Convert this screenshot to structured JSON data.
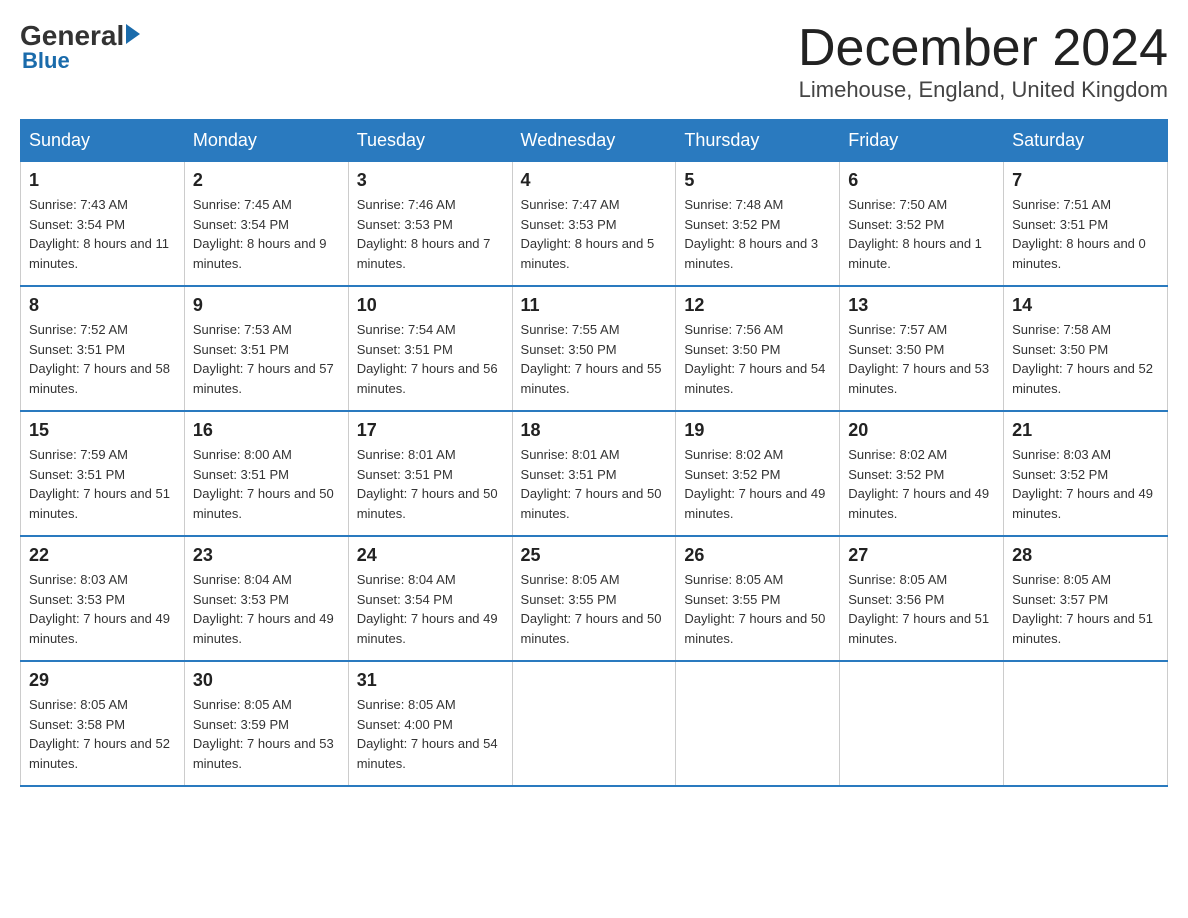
{
  "header": {
    "logo": {
      "general": "General",
      "blue": "Blue"
    },
    "title": "December 2024",
    "location": "Limehouse, England, United Kingdom"
  },
  "days_of_week": [
    "Sunday",
    "Monday",
    "Tuesday",
    "Wednesday",
    "Thursday",
    "Friday",
    "Saturday"
  ],
  "weeks": [
    [
      {
        "day": "1",
        "sunrise": "7:43 AM",
        "sunset": "3:54 PM",
        "daylight": "8 hours and 11 minutes."
      },
      {
        "day": "2",
        "sunrise": "7:45 AM",
        "sunset": "3:54 PM",
        "daylight": "8 hours and 9 minutes."
      },
      {
        "day": "3",
        "sunrise": "7:46 AM",
        "sunset": "3:53 PM",
        "daylight": "8 hours and 7 minutes."
      },
      {
        "day": "4",
        "sunrise": "7:47 AM",
        "sunset": "3:53 PM",
        "daylight": "8 hours and 5 minutes."
      },
      {
        "day": "5",
        "sunrise": "7:48 AM",
        "sunset": "3:52 PM",
        "daylight": "8 hours and 3 minutes."
      },
      {
        "day": "6",
        "sunrise": "7:50 AM",
        "sunset": "3:52 PM",
        "daylight": "8 hours and 1 minute."
      },
      {
        "day": "7",
        "sunrise": "7:51 AM",
        "sunset": "3:51 PM",
        "daylight": "8 hours and 0 minutes."
      }
    ],
    [
      {
        "day": "8",
        "sunrise": "7:52 AM",
        "sunset": "3:51 PM",
        "daylight": "7 hours and 58 minutes."
      },
      {
        "day": "9",
        "sunrise": "7:53 AM",
        "sunset": "3:51 PM",
        "daylight": "7 hours and 57 minutes."
      },
      {
        "day": "10",
        "sunrise": "7:54 AM",
        "sunset": "3:51 PM",
        "daylight": "7 hours and 56 minutes."
      },
      {
        "day": "11",
        "sunrise": "7:55 AM",
        "sunset": "3:50 PM",
        "daylight": "7 hours and 55 minutes."
      },
      {
        "day": "12",
        "sunrise": "7:56 AM",
        "sunset": "3:50 PM",
        "daylight": "7 hours and 54 minutes."
      },
      {
        "day": "13",
        "sunrise": "7:57 AM",
        "sunset": "3:50 PM",
        "daylight": "7 hours and 53 minutes."
      },
      {
        "day": "14",
        "sunrise": "7:58 AM",
        "sunset": "3:50 PM",
        "daylight": "7 hours and 52 minutes."
      }
    ],
    [
      {
        "day": "15",
        "sunrise": "7:59 AM",
        "sunset": "3:51 PM",
        "daylight": "7 hours and 51 minutes."
      },
      {
        "day": "16",
        "sunrise": "8:00 AM",
        "sunset": "3:51 PM",
        "daylight": "7 hours and 50 minutes."
      },
      {
        "day": "17",
        "sunrise": "8:01 AM",
        "sunset": "3:51 PM",
        "daylight": "7 hours and 50 minutes."
      },
      {
        "day": "18",
        "sunrise": "8:01 AM",
        "sunset": "3:51 PM",
        "daylight": "7 hours and 50 minutes."
      },
      {
        "day": "19",
        "sunrise": "8:02 AM",
        "sunset": "3:52 PM",
        "daylight": "7 hours and 49 minutes."
      },
      {
        "day": "20",
        "sunrise": "8:02 AM",
        "sunset": "3:52 PM",
        "daylight": "7 hours and 49 minutes."
      },
      {
        "day": "21",
        "sunrise": "8:03 AM",
        "sunset": "3:52 PM",
        "daylight": "7 hours and 49 minutes."
      }
    ],
    [
      {
        "day": "22",
        "sunrise": "8:03 AM",
        "sunset": "3:53 PM",
        "daylight": "7 hours and 49 minutes."
      },
      {
        "day": "23",
        "sunrise": "8:04 AM",
        "sunset": "3:53 PM",
        "daylight": "7 hours and 49 minutes."
      },
      {
        "day": "24",
        "sunrise": "8:04 AM",
        "sunset": "3:54 PM",
        "daylight": "7 hours and 49 minutes."
      },
      {
        "day": "25",
        "sunrise": "8:05 AM",
        "sunset": "3:55 PM",
        "daylight": "7 hours and 50 minutes."
      },
      {
        "day": "26",
        "sunrise": "8:05 AM",
        "sunset": "3:55 PM",
        "daylight": "7 hours and 50 minutes."
      },
      {
        "day": "27",
        "sunrise": "8:05 AM",
        "sunset": "3:56 PM",
        "daylight": "7 hours and 51 minutes."
      },
      {
        "day": "28",
        "sunrise": "8:05 AM",
        "sunset": "3:57 PM",
        "daylight": "7 hours and 51 minutes."
      }
    ],
    [
      {
        "day": "29",
        "sunrise": "8:05 AM",
        "sunset": "3:58 PM",
        "daylight": "7 hours and 52 minutes."
      },
      {
        "day": "30",
        "sunrise": "8:05 AM",
        "sunset": "3:59 PM",
        "daylight": "7 hours and 53 minutes."
      },
      {
        "day": "31",
        "sunrise": "8:05 AM",
        "sunset": "4:00 PM",
        "daylight": "7 hours and 54 minutes."
      },
      null,
      null,
      null,
      null
    ]
  ],
  "labels": {
    "sunrise": "Sunrise:",
    "sunset": "Sunset:",
    "daylight": "Daylight:"
  }
}
